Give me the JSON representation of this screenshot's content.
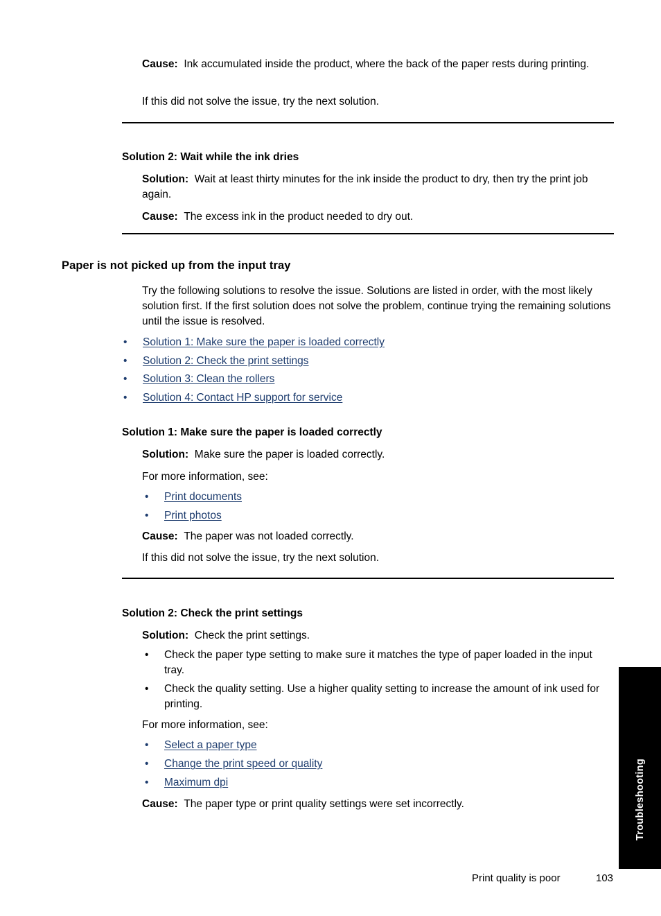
{
  "document": {
    "footer": {
      "section_title": "Print quality is poor",
      "page_number": "103"
    },
    "side_tab": {
      "label": "Troubleshooting"
    }
  },
  "blocks": {
    "cause_intro": {
      "label": "Cause:",
      "text": "Ink accumulated inside the product, where the back of the paper rests during printing."
    },
    "next_solution_1": "If this did not solve the issue, try the next solution.",
    "solution2_ink_dries": {
      "heading": "Solution 2: Wait while the ink dries",
      "solution_label": "Solution:",
      "solution_text": "Wait at least thirty minutes for the ink inside the product to dry, then try the print job again.",
      "cause_label": "Cause:",
      "cause_text": "The excess ink in the product needed to dry out."
    },
    "paper_not_picked": {
      "heading": "Paper is not picked up from the input tray",
      "intro": "Try the following solutions to resolve the issue. Solutions are listed in order, with the most likely solution first. If the first solution does not solve the problem, continue trying the remaining solutions until the issue is resolved.",
      "links": [
        "Solution 1: Make sure the paper is loaded correctly",
        "Solution 2: Check the print settings",
        "Solution 3: Clean the rollers",
        "Solution 4: Contact HP support for service"
      ]
    },
    "solution1_paper_loaded": {
      "heading": "Solution 1: Make sure the paper is loaded correctly",
      "solution_label": "Solution:",
      "solution_text": "Make sure the paper is loaded correctly.",
      "more_info": "For more information, see:",
      "links": [
        "Print documents",
        "Print photos"
      ],
      "cause_label": "Cause:",
      "cause_text": "The paper was not loaded correctly.",
      "next_solution": "If this did not solve the issue, try the next solution."
    },
    "solution2_print_settings": {
      "heading": "Solution 2: Check the print settings",
      "solution_label": "Solution:",
      "solution_text": "Check the print settings.",
      "bullets": [
        "Check the paper type setting to make sure it matches the type of paper loaded in the input tray.",
        "Check the quality setting. Use a higher quality setting to increase the amount of ink used for printing."
      ],
      "more_info": "For more information, see:",
      "links": [
        "Select a paper type",
        "Change the print speed or quality",
        "Maximum dpi"
      ],
      "cause_label": "Cause:",
      "cause_text": "The paper type or print quality settings were set incorrectly."
    }
  },
  "bullet_glyph": "•"
}
